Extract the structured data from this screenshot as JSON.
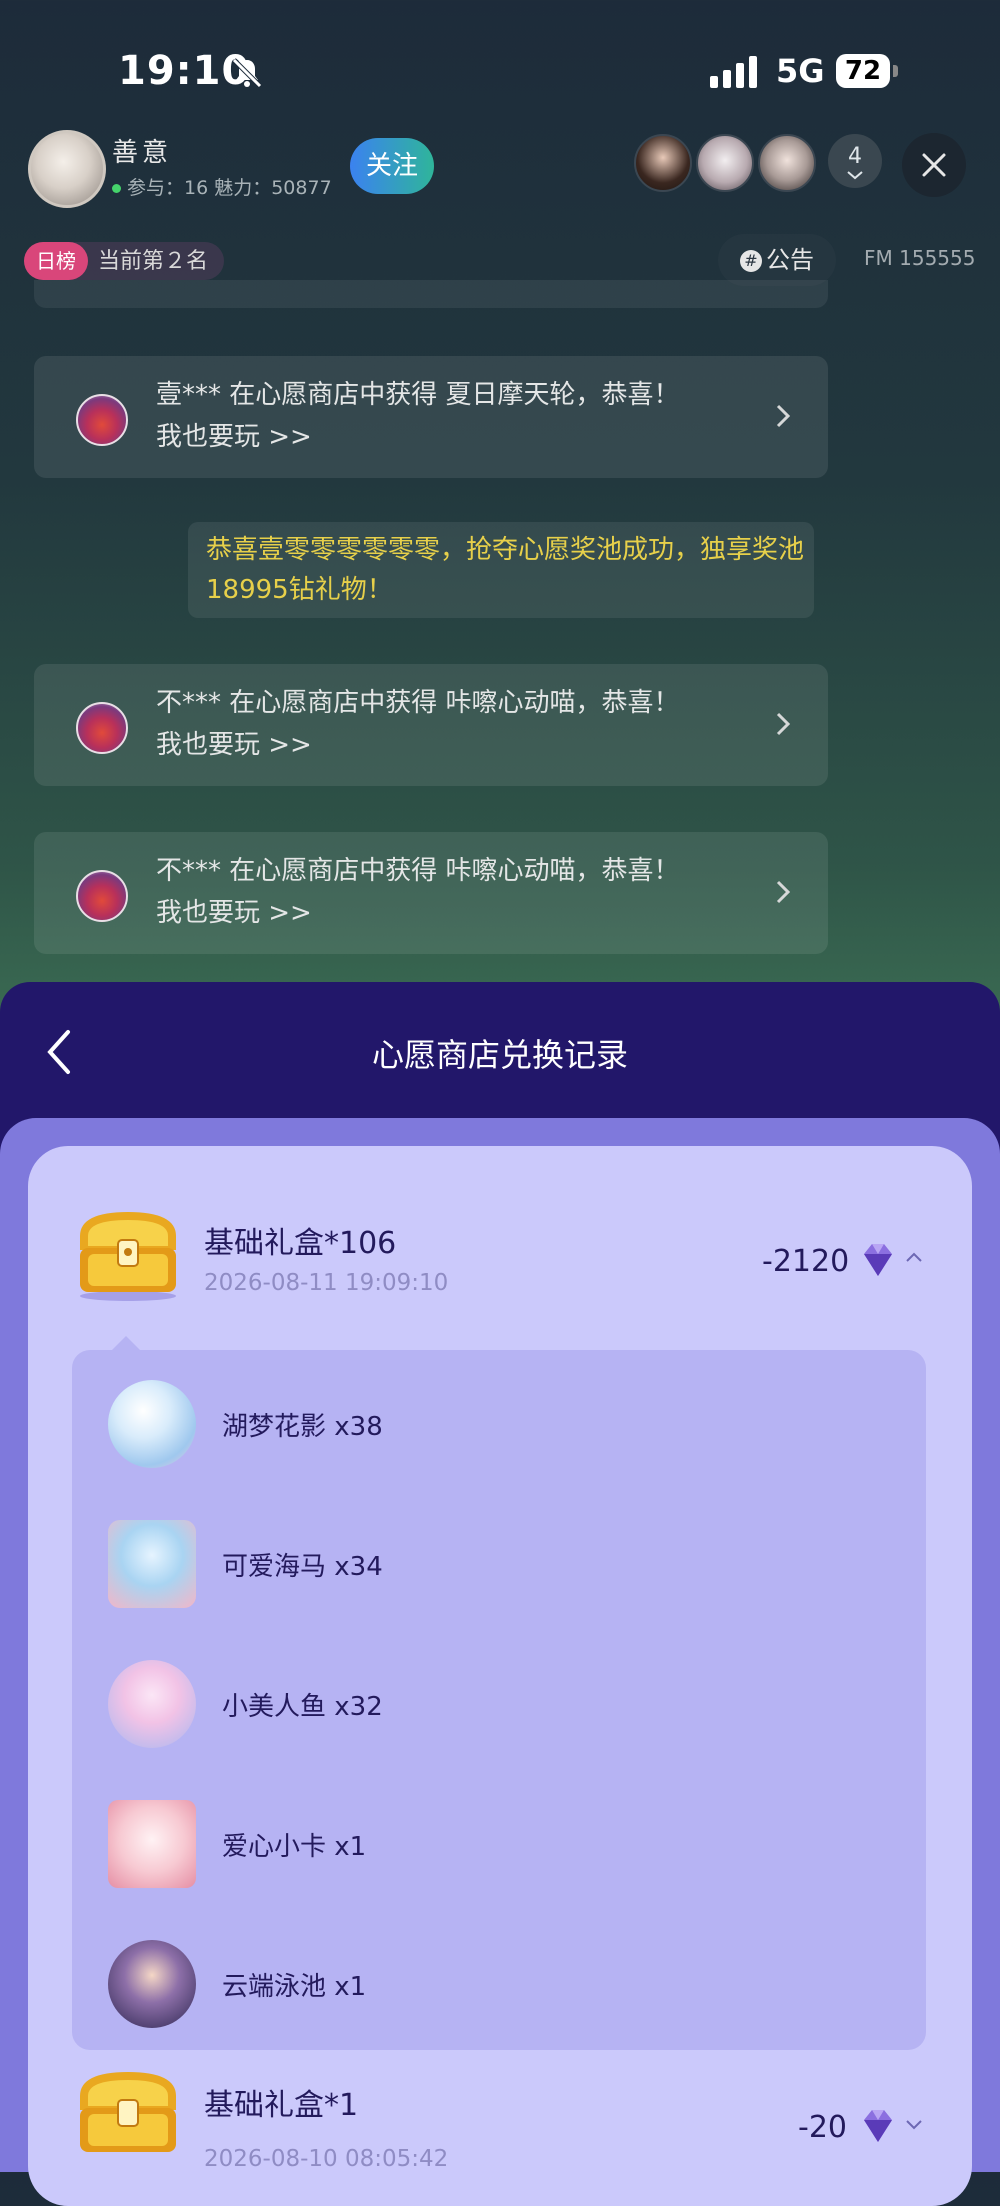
{
  "status_bar": {
    "time": "19:10",
    "network": "5G",
    "battery": "72"
  },
  "room": {
    "host_name": "善意",
    "host_stats": "参与：16 魅力：50877",
    "follow_label": "关注",
    "viewer_count": "4",
    "rank_tag": "日榜",
    "rank_text": "当前第２名",
    "notice_label": "公告",
    "fm_id": "FM 155555"
  },
  "chat": {
    "messages": [
      {
        "line1": "壹*** 在心愿商店中获得 夏日摩天轮，恭喜！",
        "line2": "我也要玩 >>"
      },
      {
        "line1": "不*** 在心愿商店中获得 咔嚓心动喵，恭喜！",
        "line2": "我也要玩 >>"
      },
      {
        "line1": "不*** 在心愿商店中获得 咔嚓心动喵，恭喜！",
        "line2": "我也要玩 >>"
      }
    ],
    "system_message": "恭喜壹零零零零零零，抢夺心愿奖池成功，独享奖池18995钻礼物！"
  },
  "sheet": {
    "title": "心愿商店兑换记录",
    "records": [
      {
        "name": "基础礼盒*106",
        "date": "2026-08-11 19:09:10",
        "amount": "-2120",
        "expanded": true
      },
      {
        "name": "基础礼盒*1",
        "date": "2026-08-10 08:05:42",
        "amount": "-20",
        "expanded": false
      }
    ],
    "gifts": [
      {
        "label": "湖梦花影 x38",
        "icon": "bubble-flower-icon",
        "color": "#cfe6f7"
      },
      {
        "label": "可爱海马 x34",
        "icon": "seahorse-icon",
        "color": "#a9d4f2"
      },
      {
        "label": "小美人鱼 x32",
        "icon": "mermaid-icon",
        "color": "#f2c3e6"
      },
      {
        "label": "爱心小卡 x1",
        "icon": "heart-card-icon",
        "color": "#f7c9d2"
      },
      {
        "label": "云端泳池 x1",
        "icon": "cloud-pool-icon",
        "color": "#3d3570"
      }
    ]
  },
  "colors": {
    "accent_purple": "#22176a",
    "card_lavender": "#cbc9fb",
    "system_text": "#e7d04a"
  }
}
